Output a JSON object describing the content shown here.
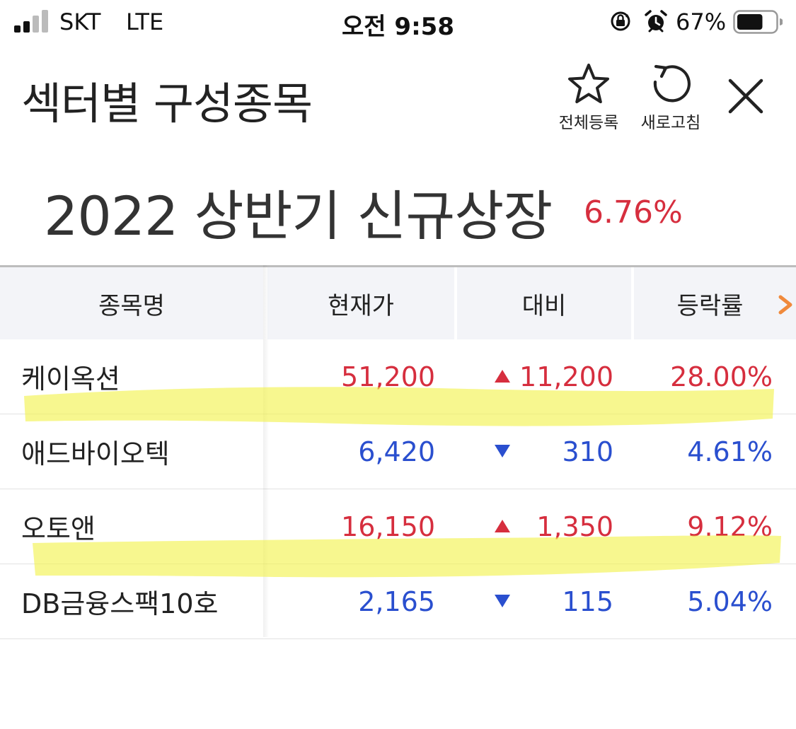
{
  "status_bar": {
    "carrier": "SKT",
    "network": "LTE",
    "time": "오전 9:58",
    "battery_percent": "67%",
    "battery_level": 0.67,
    "icons": [
      "signal-icon",
      "orientation-lock-icon",
      "alarm-icon",
      "battery-icon"
    ]
  },
  "header": {
    "title": "섹터별 구성종목",
    "register_all_label": "전체등록",
    "refresh_label": "새로고침",
    "icons": [
      "star-icon",
      "refresh-icon",
      "close-icon"
    ]
  },
  "sector": {
    "name": "2022 상반기 신규상장",
    "change_rate": "6.76%"
  },
  "table": {
    "columns": [
      "종목명",
      "현재가",
      "대비",
      "등락률"
    ],
    "rows": [
      {
        "name": "케이옥션",
        "price": "51,200",
        "direction": "up",
        "diff": "11,200",
        "rate": "28.00%",
        "highlighted": true
      },
      {
        "name": "애드바이오텍",
        "price": "6,420",
        "direction": "down",
        "diff": "310",
        "rate": "4.61%",
        "highlighted": false
      },
      {
        "name": "오토앤",
        "price": "16,150",
        "direction": "up",
        "diff": "1,350",
        "rate": "9.12%",
        "highlighted": true
      },
      {
        "name": "DB금융스팩10호",
        "price": "2,165",
        "direction": "down",
        "diff": "115",
        "rate": "5.04%",
        "highlighted": false
      }
    ]
  },
  "colors": {
    "up": "#d62e3e",
    "down": "#2a4fcf",
    "header_bg": "#f3f4f8",
    "accent_arrow": "#f08a3c",
    "highlighter": "#f2f24a"
  }
}
